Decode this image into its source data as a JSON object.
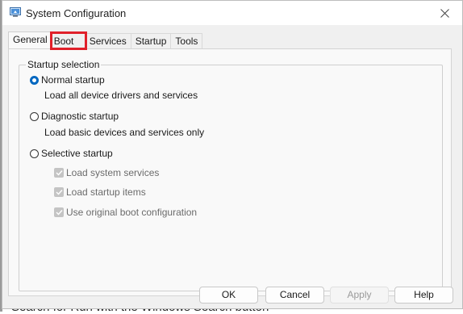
{
  "window": {
    "title": "System Configuration"
  },
  "tabs": [
    "General",
    "Boot",
    "Services",
    "Startup",
    "Tools"
  ],
  "active_tab": "General",
  "highlighted_tab": "Boot",
  "startup_selection": {
    "group_title": "Startup selection",
    "normal": {
      "label": "Normal startup",
      "description": "Load all device drivers and services",
      "checked": true
    },
    "diagnostic": {
      "label": "Diagnostic startup",
      "description": "Load basic devices and services only",
      "checked": false
    },
    "selective": {
      "label": "Selective startup",
      "checked": false,
      "options": [
        {
          "label": "Load system services",
          "checked": true,
          "enabled": false
        },
        {
          "label": "Load startup items",
          "checked": true,
          "enabled": false
        },
        {
          "label": "Use original boot configuration",
          "checked": true,
          "enabled": false
        }
      ]
    }
  },
  "buttons": {
    "ok": "OK",
    "cancel": "Cancel",
    "apply": "Apply",
    "help": "Help"
  },
  "background_text": "Search for Run with the Windows Search button",
  "colors": {
    "accent": "#0067c0",
    "highlight_box": "#e0202a"
  }
}
